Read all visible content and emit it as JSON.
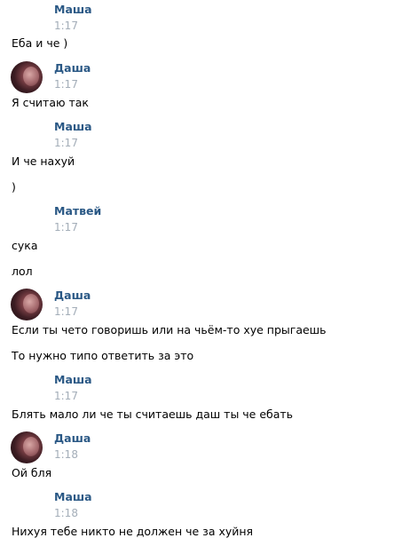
{
  "messages": [
    {
      "author": "Маша",
      "time": "1:17",
      "avatar": false,
      "texts": [
        "Еба и че )"
      ]
    },
    {
      "author": "Даша",
      "time": "1:17",
      "avatar": true,
      "texts": [
        "Я считаю так"
      ]
    },
    {
      "author": "Маша",
      "time": "1:17",
      "avatar": false,
      "texts": [
        "И че нахуй",
        ")"
      ]
    },
    {
      "author": "Матвей",
      "time": "1:17",
      "avatar": false,
      "texts": [
        "сука",
        "лол"
      ]
    },
    {
      "author": "Даша",
      "time": "1:17",
      "avatar": true,
      "texts": [
        "Если ты чето говоришь или на чьём-то хуе прыгаешь",
        "То нужно типо ответить за это"
      ]
    },
    {
      "author": "Маша",
      "time": "1:17",
      "avatar": false,
      "texts": [
        "Блять мало ли че ты считаешь даш ты че ебать"
      ]
    },
    {
      "author": "Даша",
      "time": "1:18",
      "avatar": true,
      "texts": [
        "Ой бля"
      ]
    },
    {
      "author": "Маша",
      "time": "1:18",
      "avatar": false,
      "texts": [
        "Нихуя тебе никто не должен че за хуйня"
      ]
    }
  ],
  "colors": {
    "author": "#2a5885",
    "time": "#a3adb8",
    "text": "#000000"
  },
  "icons": {
    "avatar": "user-avatar-icon"
  }
}
